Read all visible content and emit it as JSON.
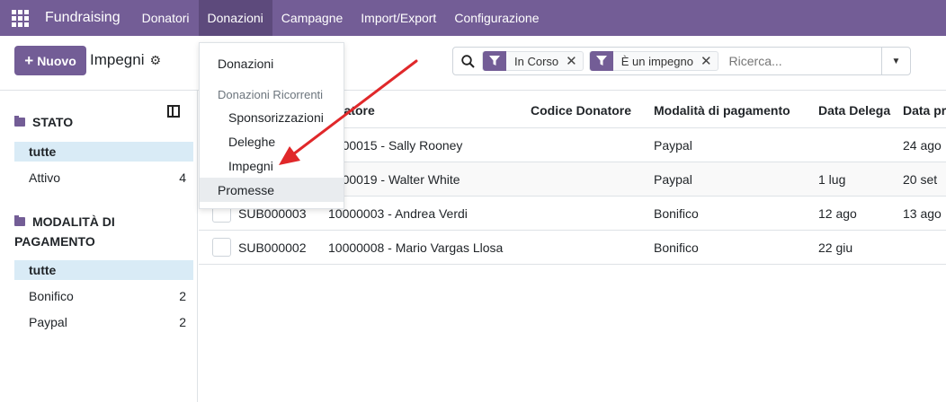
{
  "nav": {
    "app_name": "Fundraising",
    "items": [
      "Donatori",
      "Donazioni",
      "Campagne",
      "Import/Export",
      "Configurazione"
    ]
  },
  "control": {
    "new_label": "Nuovo",
    "breadcrumb": "Impegni"
  },
  "search": {
    "facets": [
      "In Corso",
      "È un impegno"
    ],
    "placeholder": "Ricerca..."
  },
  "sidebar": {
    "section1_title": "STATO",
    "section1_items": [
      {
        "label": "tutte",
        "count": ""
      },
      {
        "label": "Attivo",
        "count": "4"
      }
    ],
    "section2_title_l1": "MODALITÀ DI",
    "section2_title_l2": "PAGAMENTO",
    "section2_items": [
      {
        "label": "tutte",
        "count": ""
      },
      {
        "label": "Bonifico",
        "count": "2"
      },
      {
        "label": "Paypal",
        "count": "2"
      }
    ]
  },
  "table": {
    "headers": [
      "natore",
      "Codice Donatore",
      "Modalità di pagamento",
      "Data Delega",
      "Data pr"
    ],
    "rows": [
      {
        "ref": "",
        "donor": "0000015 - Sally Rooney",
        "payment": "Paypal",
        "delega": "",
        "data": "24 ago"
      },
      {
        "ref": "",
        "donor": "0000019 - Walter White",
        "payment": "Paypal",
        "delega": "1 lug",
        "data": "20 set"
      },
      {
        "ref": "SUB000003",
        "donor": "10000003 - Andrea Verdi",
        "payment": "Bonifico",
        "delega": "12 ago",
        "data": "13 ago"
      },
      {
        "ref": "SUB000002",
        "donor": "10000008 - Mario Vargas Llosa",
        "payment": "Bonifico",
        "delega": "22 giu",
        "data": ""
      }
    ]
  },
  "dropdown": {
    "item1": "Donazioni",
    "header": "Donazioni Ricorrenti",
    "sub1": "Sponsorizzazioni",
    "sub2": "Deleghe",
    "sub3": "Impegni",
    "item_last": "Promesse"
  },
  "colors": {
    "brand": "#735d96",
    "arrow": "#e0282a"
  }
}
